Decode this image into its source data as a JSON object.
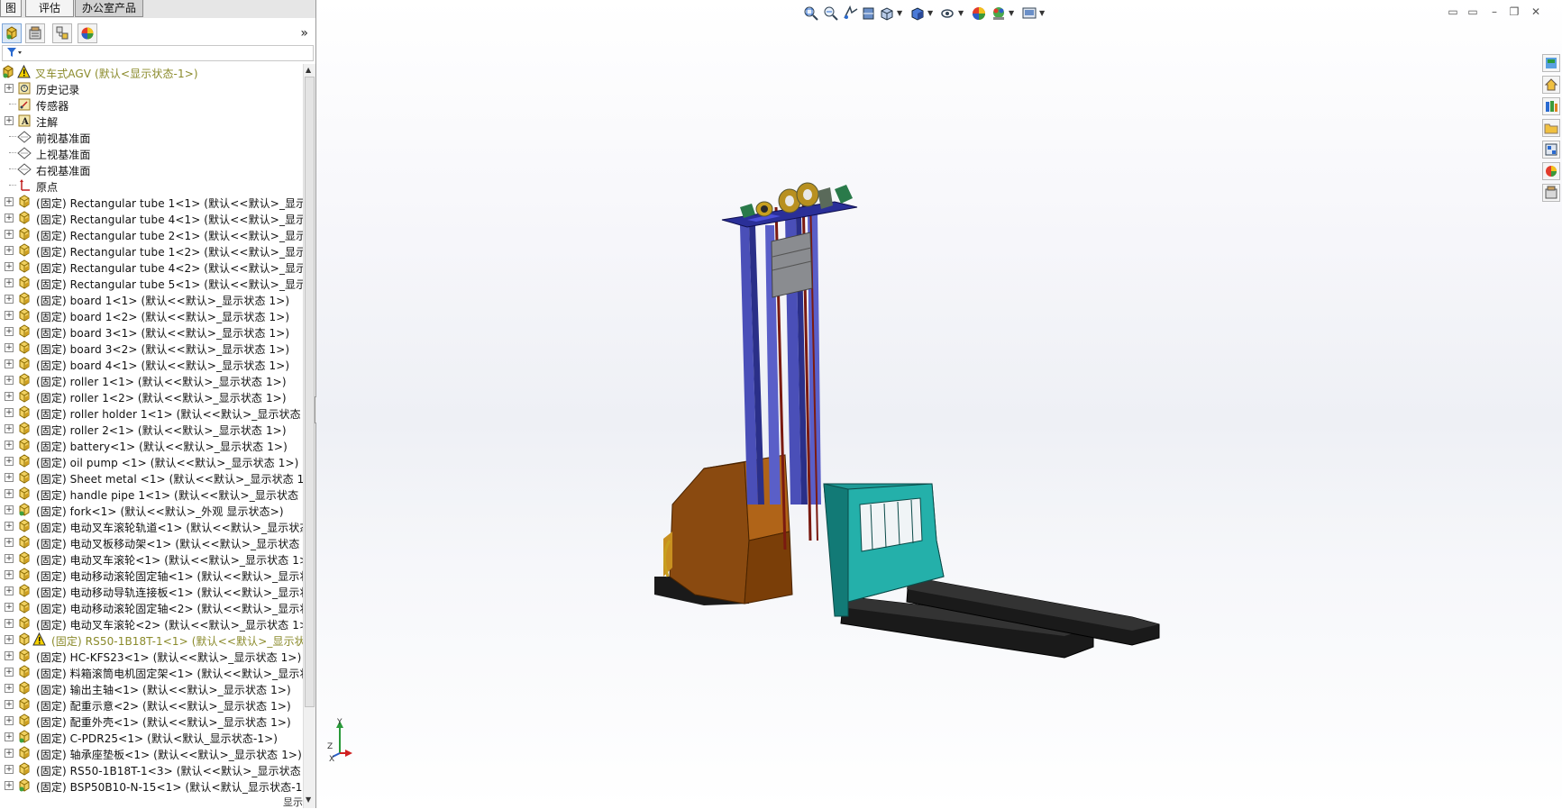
{
  "tabs": [
    "图",
    "评估",
    "办公室产品"
  ],
  "feature_manager": {
    "panel_icons": [
      "feature-tree-icon",
      "property-manager-icon",
      "configuration-manager-icon",
      "display-manager-icon"
    ],
    "expand_glyph": "»",
    "root": "叉车式AGV  (默认<显示状态-1>)",
    "items": [
      {
        "label": "历史记录",
        "type": "history"
      },
      {
        "label": "传感器",
        "type": "sensor"
      },
      {
        "label": "注解",
        "type": "annotation"
      },
      {
        "label": "前视基准面",
        "type": "plane"
      },
      {
        "label": "上视基准面",
        "type": "plane"
      },
      {
        "label": "右视基准面",
        "type": "plane"
      },
      {
        "label": "原点",
        "type": "origin"
      },
      {
        "label": "(固定) Rectangular tube 1<1> (默认<<默认>_显示状",
        "type": "part"
      },
      {
        "label": "(固定) Rectangular tube 4<1> (默认<<默认>_显示状",
        "type": "part"
      },
      {
        "label": "(固定) Rectangular tube 2<1> (默认<<默认>_显示状",
        "type": "part"
      },
      {
        "label": "(固定) Rectangular tube 1<2> (默认<<默认>_显示状",
        "type": "part"
      },
      {
        "label": "(固定) Rectangular tube 4<2> (默认<<默认>_显示状",
        "type": "part"
      },
      {
        "label": "(固定) Rectangular tube 5<1> (默认<<默认>_显示状",
        "type": "part"
      },
      {
        "label": "(固定) board 1<1> (默认<<默认>_显示状态 1>)",
        "type": "part"
      },
      {
        "label": "(固定) board 1<2> (默认<<默认>_显示状态 1>)",
        "type": "part"
      },
      {
        "label": "(固定) board 3<1> (默认<<默认>_显示状态 1>)",
        "type": "part"
      },
      {
        "label": "(固定) board 3<2> (默认<<默认>_显示状态 1>)",
        "type": "part"
      },
      {
        "label": "(固定) board 4<1> (默认<<默认>_显示状态 1>)",
        "type": "part"
      },
      {
        "label": "(固定) roller 1<1> (默认<<默认>_显示状态 1>)",
        "type": "part"
      },
      {
        "label": "(固定) roller 1<2> (默认<<默认>_显示状态 1>)",
        "type": "part"
      },
      {
        "label": "(固定) roller holder 1<1> (默认<<默认>_显示状态 1",
        "type": "part"
      },
      {
        "label": "(固定) roller 2<1> (默认<<默认>_显示状态 1>)",
        "type": "part"
      },
      {
        "label": "(固定) battery<1> (默认<<默认>_显示状态 1>)",
        "type": "part"
      },
      {
        "label": "(固定) oil pump <1> (默认<<默认>_显示状态 1>)",
        "type": "part"
      },
      {
        "label": "(固定) Sheet metal <1> (默认<<默认>_显示状态 1>)",
        "type": "part"
      },
      {
        "label": "(固定) handle pipe 1<1> (默认<<默认>_显示状态 1>",
        "type": "part"
      },
      {
        "label": "(固定) fork<1> (默认<<默认>_外观 显示状态>)",
        "type": "assembly"
      },
      {
        "label": "(固定) 电动叉车滚轮轨道<1> (默认<<默认>_显示状态",
        "type": "part"
      },
      {
        "label": "(固定) 电动叉板移动架<1> (默认<<默认>_显示状态 1",
        "type": "part"
      },
      {
        "label": "(固定) 电动叉车滚轮<1> (默认<<默认>_显示状态 1>)",
        "type": "part"
      },
      {
        "label": "(固定) 电动移动滚轮固定轴<1> (默认<<默认>_显示状",
        "type": "part"
      },
      {
        "label": "(固定) 电动移动导轨连接板<1> (默认<<默认>_显示状",
        "type": "part"
      },
      {
        "label": "(固定) 电动移动滚轮固定轴<2> (默认<<默认>_显示状",
        "type": "part"
      },
      {
        "label": "(固定) 电动叉车滚轮<2> (默认<<默认>_显示状态 1>)",
        "type": "part"
      },
      {
        "label": "(固定) RS50-1B18T-1<1> (默认<<默认>_显示状态",
        "type": "warn"
      },
      {
        "label": "(固定) HC-KFS23<1> (默认<<默认>_显示状态 1>)",
        "type": "part"
      },
      {
        "label": "(固定) 料箱滚筒电机固定架<1> (默认<<默认>_显示状",
        "type": "part"
      },
      {
        "label": "(固定) 输出主轴<1> (默认<<默认>_显示状态 1>)",
        "type": "part"
      },
      {
        "label": "(固定) 配重示意<2> (默认<<默认>_显示状态 1>)",
        "type": "part"
      },
      {
        "label": "(固定) 配重外壳<1> (默认<<默认>_显示状态 1>)",
        "type": "part"
      },
      {
        "label": "(固定) C-PDR25<1> (默认<默认_显示状态-1>)",
        "type": "assembly"
      },
      {
        "label": "(固定) 轴承座垫板<1> (默认<<默认>_显示状态 1>)",
        "type": "part"
      },
      {
        "label": "(固定) RS50-1B18T-1<3> (默认<<默认>_显示状态 1",
        "type": "part"
      },
      {
        "label": "(固定) BSP50B10-N-15<1> (默认<默认_显示状态-1>)",
        "type": "assembly"
      }
    ],
    "bottom_label": "显示"
  },
  "viewport": {
    "hud_icons": [
      "zoom-to-fit-icon",
      "zoom-area-icon",
      "previous-view-icon",
      "section-view-icon",
      "view-orientation-icon",
      "display-style-icon",
      "hide-show-icon",
      "appearance-icon",
      "scene-icon",
      "view-settings-icon"
    ],
    "window_controls": [
      "tile-h",
      "tile-v",
      "minimize",
      "restore",
      "close"
    ],
    "task_pane_icons": [
      "solidworks-resources-icon",
      "home-icon",
      "design-library-icon",
      "file-explorer-icon",
      "view-palette-icon",
      "appearances-icon",
      "custom-properties-icon"
    ],
    "triad": {
      "x": "X",
      "y": "Y",
      "z": "Z"
    }
  },
  "colors": {
    "accent_warning": "#8a8a2a",
    "viewport_bg": "#eef0f5"
  }
}
